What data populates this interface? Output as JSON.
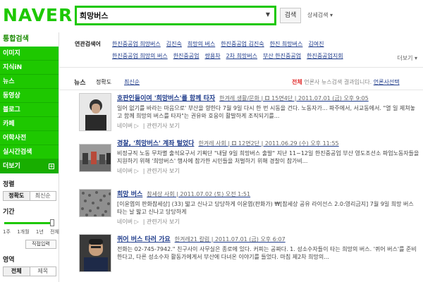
{
  "header": {
    "logo": "NAVER",
    "search_value": "희망버스",
    "search_button": "검색",
    "advanced": "상세검색 ▾"
  },
  "sidebar": {
    "total_search": "통합검색",
    "items": [
      "이미지",
      "지식iN",
      "뉴스",
      "동영상",
      "블로그",
      "카페",
      "어학사전",
      "실시간검색"
    ],
    "more": "더보기",
    "sort": {
      "heading": "정렬",
      "options": [
        "정확도",
        "최신순"
      ]
    },
    "period": {
      "heading": "기간",
      "ticks": [
        "1주",
        "1개월",
        "1년",
        "전체"
      ],
      "direct": "직접입력"
    },
    "area": {
      "heading": "영역",
      "options": [
        "전체",
        "제목"
      ]
    }
  },
  "related": {
    "label": "연관검색어",
    "row1": [
      "한진중공업 희망버스",
      "김진숙",
      "희망의 버스",
      "한진중공업 김진숙",
      "한진 희망버스",
      "김여진"
    ],
    "row2": [
      "한진중공업 희망의 버스",
      "한진중공업",
      "쌍용차",
      "2차 희망버스",
      "부산 한진중공업",
      "한진중공업지회"
    ],
    "more": "더보기 ▾"
  },
  "news_tabs": {
    "title": "뉴스",
    "sort_accuracy": "정확도",
    "sort_latest": "최신순",
    "all": "전체",
    "desc": "언론사 뉴스검색 결과입니다.",
    "media_select": "언론사선택"
  },
  "results": [
    {
      "title_pre": "호판인들이여 '희망",
      "title_bold": "버스",
      "title_post": "'를 함께 타자",
      "meta": "한겨레 생활/문화 | ⚃ 15면4단 | 2011.07.01 (금) 오후 9:05",
      "desc": "일어 없기를 바라는 마음으로' 부산을 향한다 7월 9일 다시 한 번 시동을 건다. 노동자가... 파주에서, 서교동에서. \"열 일 제쳐놓고 함께 희망의 버스를 타자\"는 권유와 호응이 활발하게 조직되기를...",
      "actions": [
        "네이버 ▷",
        "관련기사 보기"
      ]
    },
    {
      "title_pre": "경찰, '희망",
      "title_bold": "버스",
      "title_post": "' 계좌 털었다",
      "meta": "한겨레 사회 | ⚃ 12면2단 | 2011.06.29 (수) 오후 11:55",
      "desc": "비정규직 노동 무차별 출석요구서 기획단 \"내달 9일 희망버스 출발\" 지난 11~12일 한진중공업 부산 영도조선소 파업노동자들을 지원하기 위해 '희망버스' 행사에 참가한 시민들을 처벌하기 위해 경찰이 참가비...",
      "actions": [
        "네이버 ▷",
        "관련기사 보기"
      ]
    },
    {
      "title_pre": "희망 ",
      "title_bold": "버스",
      "title_post": "",
      "meta": "참세상 사회 | 2011.07.02 (토) 오전 1:51",
      "desc": "[이윤엽의 판화참세상] (33) 밟고 신나고 당당하게 이윤엽(판화가) ₩[참세상 공유 라이선스 2.0:영리금지] 7월 9일 희망 버스 타는 날 밟고 신나고 당당하게",
      "actions": [
        "네이버 ▷",
        "관련기사 보기"
      ]
    },
    {
      "title_pre": "퀴어 ",
      "title_bold": "버스",
      "title_post": " 타러 가요",
      "meta": "한겨레21 칼럼 | 2011.07.01 (금) 오후 6:07",
      "desc": "전화는 02-745-7942.\" 친구사이 사무실은 종로에 있다. 커피는 공짜다. 1. 성소수자들이 타는 희망의 버스. '퀴어 버스'를 준비한다고, 다른 성소수자 활동가에게서 부산에 다녀온 이야기를 들었다. 마침 제2차 희망의...",
      "actions": [
        "네이버 ▷",
        "관련기사 보기"
      ]
    }
  ],
  "colors": {
    "brand": "#1ec800",
    "link": "#1d3a8a"
  }
}
